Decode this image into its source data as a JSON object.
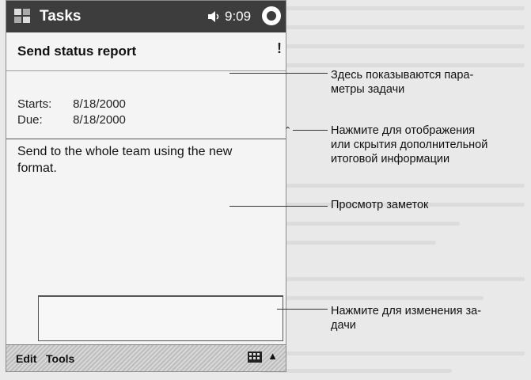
{
  "titlebar": {
    "title": "Tasks",
    "clock": "9:09"
  },
  "task": {
    "title": "Send status report",
    "start_label": "Starts:",
    "start_value": "8/18/2000",
    "due_label": "Due:",
    "due_value": "8/18/2000",
    "notes": "Send to the whole team using the new format."
  },
  "menubar": {
    "edit": "Edit",
    "tools": "Tools"
  },
  "callouts": {
    "details": "Здесь показываются пара-\nметры задачи",
    "toggle": "Нажмите для отображения\nили скрытия дополнительной\nитоговой информации",
    "notes": "Просмотр заметок",
    "edit": "Нажмите для изменения за-\nдачи"
  },
  "icons": [
    "windows-start-icon",
    "speaker-icon",
    "ok-icon",
    "chevron-up-icon",
    "keyboard-icon",
    "caret-up-icon"
  ]
}
